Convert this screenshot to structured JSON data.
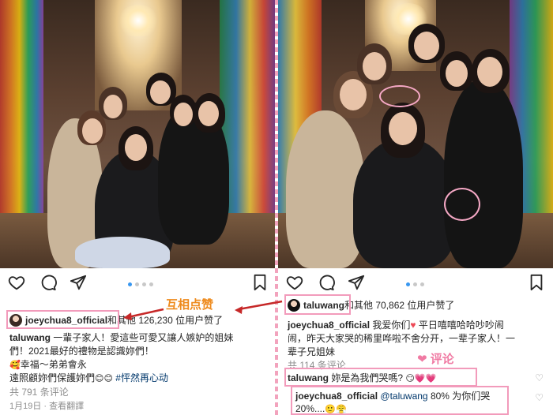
{
  "left": {
    "username": "joeychua8_official",
    "liked_suffix": "和其他 126,230 位用户赞了",
    "caption_user": "taluwang",
    "caption_line1": " 一輩子家人！愛這些可愛又讓人嫉妒的姐妹",
    "caption_line2": "們！2021最好的禮物是認識妳們！",
    "caption_line3_a": "幸福～弟弟會永",
    "caption_line4_a": "遠照顧妳們保護妳們",
    "hashtag": "#怦然再心动",
    "comments_count": "共 791 条评论",
    "date": "1月19日",
    "translate": "查看翻譯",
    "emoji_face": "🥰",
    "emoji_pair": "😊😊"
  },
  "annotation": {
    "mutual_like": "互相点赞",
    "comment": "评论"
  },
  "right": {
    "username": "taluwang",
    "liked_suffix": "和其他 70,862 位用户赞了",
    "caption_user": "joeychua8_official",
    "caption_line1": " 我爱你们",
    "caption_line1_b": " 平日嘻嘻哈哈吵吵闹",
    "caption_line2": "闹，昨天大家哭的稀里哗啦不舍分开，一辈子家人！一",
    "caption_line3": "辈子兄姐妹",
    "comments_count": "共 114 条评论",
    "comment1_user": "taluwang",
    "comment1_text": " 妳是為我們哭嗎?",
    "comment1_emoji": "😏💗💗",
    "reply_user": "joeychua8_official",
    "reply_mention": "@taluwang",
    "reply_text": " 80% 为你们哭",
    "reply_line2": "20%....",
    "reply_emoji": "🙂😤",
    "heart": "♥"
  },
  "icons": {
    "like": "heart-icon",
    "comment": "comment-icon",
    "share": "send-icon",
    "save": "bookmark-icon"
  },
  "colors": {
    "annotation_orange": "#ee8a1c",
    "annotation_pink": "#f07aa3",
    "highlight_box": "#f29bbb",
    "carousel_active": "#3897f0"
  }
}
